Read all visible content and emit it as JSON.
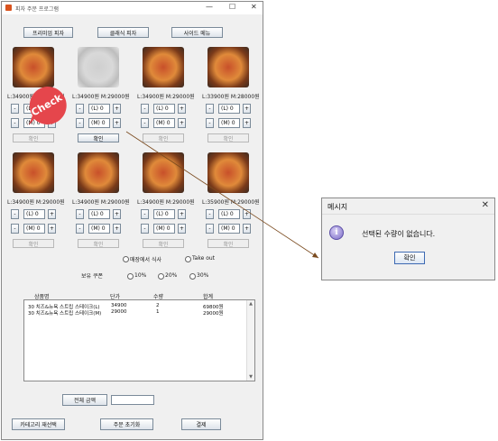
{
  "window": {
    "title": "피자 주문 프로그램",
    "controls": [
      "—",
      "☐",
      "✕"
    ]
  },
  "categories": [
    "프리미엄 피자",
    "클래식 피자",
    "사이드 메뉴"
  ],
  "row1": [
    {
      "price": "L:34900원 M:29000원",
      "large": "(L) 0",
      "medium": "(M) 0",
      "confirm": "확인",
      "gray": false,
      "enabled": false
    },
    {
      "price": "L:34900원 M:29000원",
      "large": "(L) 0",
      "medium": "(M) 0",
      "confirm": "확인",
      "gray": true,
      "enabled": true
    },
    {
      "price": "L:34900원 M:29000원",
      "large": "(L) 0",
      "medium": "(M) 0",
      "confirm": "확인",
      "gray": false,
      "enabled": false
    },
    {
      "price": "L:33900원 M:28000원",
      "large": "(L) 0",
      "medium": "(M) 0",
      "confirm": "확인",
      "gray": false,
      "enabled": false
    }
  ],
  "row2": [
    {
      "price": "L:34900원 M:29000원",
      "large": "(L) 0",
      "medium": "(M) 0",
      "confirm": "확인"
    },
    {
      "price": "L:34900원 M:29000원",
      "large": "(L) 0",
      "medium": "(M) 0",
      "confirm": "확인"
    },
    {
      "price": "L:34900원 M:29000원",
      "large": "(L) 0",
      "medium": "(M) 0",
      "confirm": "확인"
    },
    {
      "price": "L:35900원 M:29000원",
      "large": "(L) 0",
      "medium": "(M) 0",
      "confirm": "확인"
    }
  ],
  "stepper": {
    "minus": "-",
    "plus": "+"
  },
  "dine": {
    "in": "매장에서 식사",
    "out": "Take out"
  },
  "coupon": {
    "label": "보유 쿠폰",
    "options": [
      "10%",
      "20%",
      "30%"
    ]
  },
  "table": {
    "headers": [
      "상품명",
      "단가",
      "수량",
      "합계"
    ],
    "rows": [
      [
        "30 치즈&뉴욕 스트립 스테이크(L)",
        "34900",
        "2",
        "69800원"
      ],
      [
        "30 치즈&뉴욕 스트립 스테이크(M)",
        "29000",
        "1",
        "29000원"
      ]
    ]
  },
  "total": {
    "label": "전체 금액",
    "value": ""
  },
  "bottom_buttons": [
    "카테고리 재선택",
    "주문 초기화",
    "결제"
  ],
  "annotation": {
    "text": "Check",
    "color": "#e5464c"
  },
  "dialog": {
    "title": "메시지",
    "close": "✕",
    "icon": "i",
    "message": "선택된 수량이 없습니다.",
    "ok": "확인"
  },
  "colors": {
    "accent": "#e5464c",
    "connector": "#7a4a1e"
  }
}
